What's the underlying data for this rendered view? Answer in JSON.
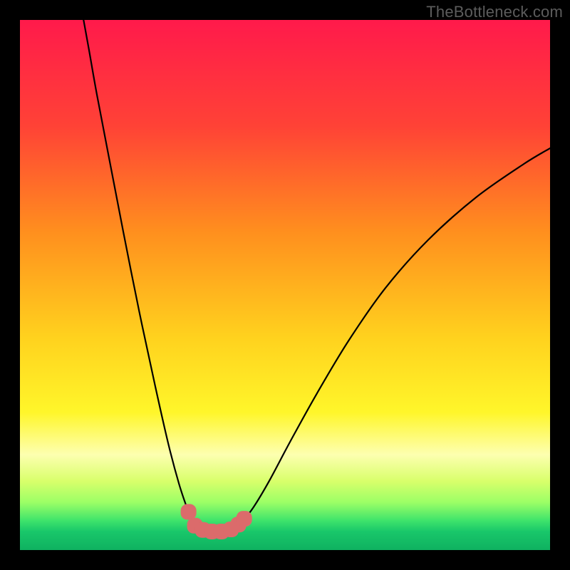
{
  "watermark": "TheBottleneck.com",
  "chart_data": {
    "type": "line",
    "title": "",
    "xlabel": "",
    "ylabel": "",
    "xlim": [
      0,
      100
    ],
    "ylim": [
      0,
      100
    ],
    "background_gradient": {
      "stops": [
        {
          "offset": 0.0,
          "color": "#ff1a4b"
        },
        {
          "offset": 0.2,
          "color": "#ff4236"
        },
        {
          "offset": 0.4,
          "color": "#ff8f1e"
        },
        {
          "offset": 0.6,
          "color": "#ffd21e"
        },
        {
          "offset": 0.74,
          "color": "#fff62a"
        },
        {
          "offset": 0.82,
          "color": "#fdffb0"
        },
        {
          "offset": 0.87,
          "color": "#d8ff6b"
        },
        {
          "offset": 0.91,
          "color": "#9cff66"
        },
        {
          "offset": 0.945,
          "color": "#3de36b"
        },
        {
          "offset": 0.965,
          "color": "#19c76a"
        },
        {
          "offset": 1.0,
          "color": "#0fb160"
        }
      ]
    },
    "series": [
      {
        "name": "bottleneck-curve",
        "stroke": "#000000",
        "stroke_width": 2.2,
        "points": [
          {
            "x": 12.0,
            "y": 100.0
          },
          {
            "x": 13.0,
            "y": 94.5
          },
          {
            "x": 14.5,
            "y": 86.0
          },
          {
            "x": 16.8,
            "y": 74.0
          },
          {
            "x": 19.5,
            "y": 60.0
          },
          {
            "x": 22.5,
            "y": 45.0
          },
          {
            "x": 25.5,
            "y": 31.0
          },
          {
            "x": 28.0,
            "y": 20.0
          },
          {
            "x": 30.0,
            "y": 12.5
          },
          {
            "x": 31.5,
            "y": 8.0
          },
          {
            "x": 32.5,
            "y": 5.5
          },
          {
            "x": 33.5,
            "y": 4.2
          },
          {
            "x": 35.0,
            "y": 3.6
          },
          {
            "x": 37.0,
            "y": 3.5
          },
          {
            "x": 39.0,
            "y": 3.7
          },
          {
            "x": 40.5,
            "y": 4.3
          },
          {
            "x": 42.0,
            "y": 5.5
          },
          {
            "x": 44.0,
            "y": 8.0
          },
          {
            "x": 47.0,
            "y": 13.0
          },
          {
            "x": 51.0,
            "y": 20.5
          },
          {
            "x": 56.0,
            "y": 29.5
          },
          {
            "x": 62.0,
            "y": 39.5
          },
          {
            "x": 69.0,
            "y": 49.5
          },
          {
            "x": 77.0,
            "y": 58.5
          },
          {
            "x": 86.0,
            "y": 66.5
          },
          {
            "x": 95.0,
            "y": 72.8
          },
          {
            "x": 100.0,
            "y": 75.8
          }
        ]
      },
      {
        "name": "highlight-markers",
        "stroke": "#db6b6b",
        "marker_shape": "rounded-square",
        "marker_size": 22,
        "points": [
          {
            "x": 31.8,
            "y": 7.2
          },
          {
            "x": 33.0,
            "y": 4.6
          },
          {
            "x": 34.5,
            "y": 3.8
          },
          {
            "x": 36.2,
            "y": 3.5
          },
          {
            "x": 38.0,
            "y": 3.5
          },
          {
            "x": 39.8,
            "y": 3.9
          },
          {
            "x": 41.2,
            "y": 4.8
          },
          {
            "x": 42.3,
            "y": 5.9
          }
        ]
      }
    ]
  }
}
